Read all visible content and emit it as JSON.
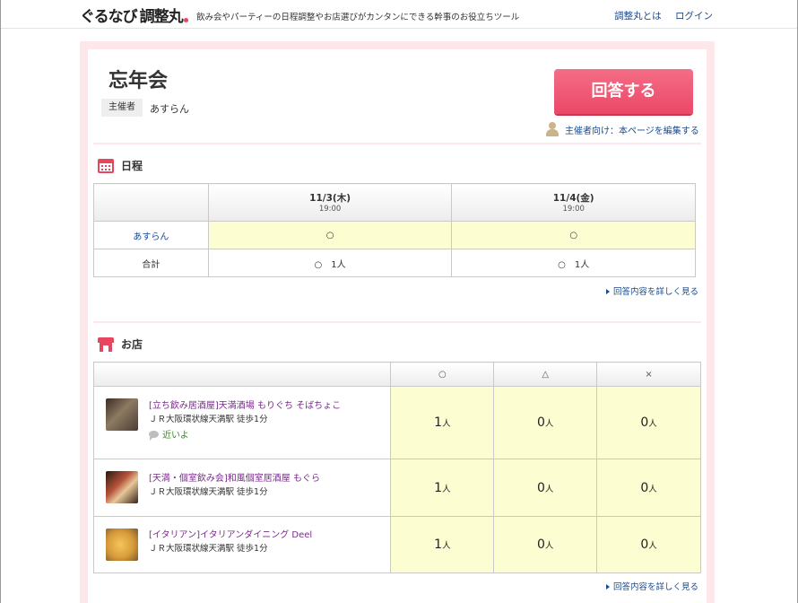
{
  "header": {
    "logo_gurunavi": "ぐるなび",
    "logo_chousei": "調整丸",
    "tagline": "飲み会やパーティーの日程調整やお店選びがカンタンにできる幹事のお役立ちツール",
    "links": [
      "調整丸とは",
      "ログイン"
    ]
  },
  "event": {
    "title": "忘年会",
    "organizer_label": "主催者",
    "organizer_name": "あすらん",
    "answer_button": "回答する",
    "edit_link": "主催者向け：本ページを編集する"
  },
  "schedule": {
    "heading": "日程",
    "dates": [
      {
        "date": "11/3(木)",
        "time": "19:00"
      },
      {
        "date": "11/4(金)",
        "time": "19:00"
      }
    ],
    "rows": [
      {
        "name": "あすらん",
        "answers": [
          "○",
          "○"
        ]
      }
    ],
    "total_label": "合計",
    "totals": [
      "○　1人",
      "○　1人"
    ],
    "detail_link": "回答内容を詳しく見る"
  },
  "shops": {
    "heading": "お店",
    "columns": [
      "○",
      "△",
      "×"
    ],
    "unit": "人",
    "items": [
      {
        "name": "[立ち飲み居酒屋]天満酒場 もりぐち そばちょこ",
        "access": "ＪＲ大阪環状線天満駅 徒歩1分",
        "comment": "近いよ",
        "counts": [
          "1",
          "0",
          "0"
        ],
        "thumb_color": "#5a4a3e"
      },
      {
        "name": "[天満・個室飲み会]和風個室居酒屋 もぐら",
        "access": "ＪＲ大阪環状線天満駅 徒歩1分",
        "comment": "",
        "counts": [
          "1",
          "0",
          "0"
        ],
        "thumb_color": "#6b3a26"
      },
      {
        "name": "[イタリアン]イタリアンダイニング Deel",
        "access": "ＪＲ大阪環状線天満駅 徒歩1分",
        "comment": "",
        "counts": [
          "1",
          "0",
          "0"
        ],
        "thumb_color": "#d8a24a"
      }
    ],
    "detail_link": "回答内容を詳しく見る"
  },
  "colors": {
    "accent": "#e8455f",
    "link": "#1a4a8f",
    "answer_cell": "#fdfdd2",
    "frame": "#fde7ea"
  }
}
